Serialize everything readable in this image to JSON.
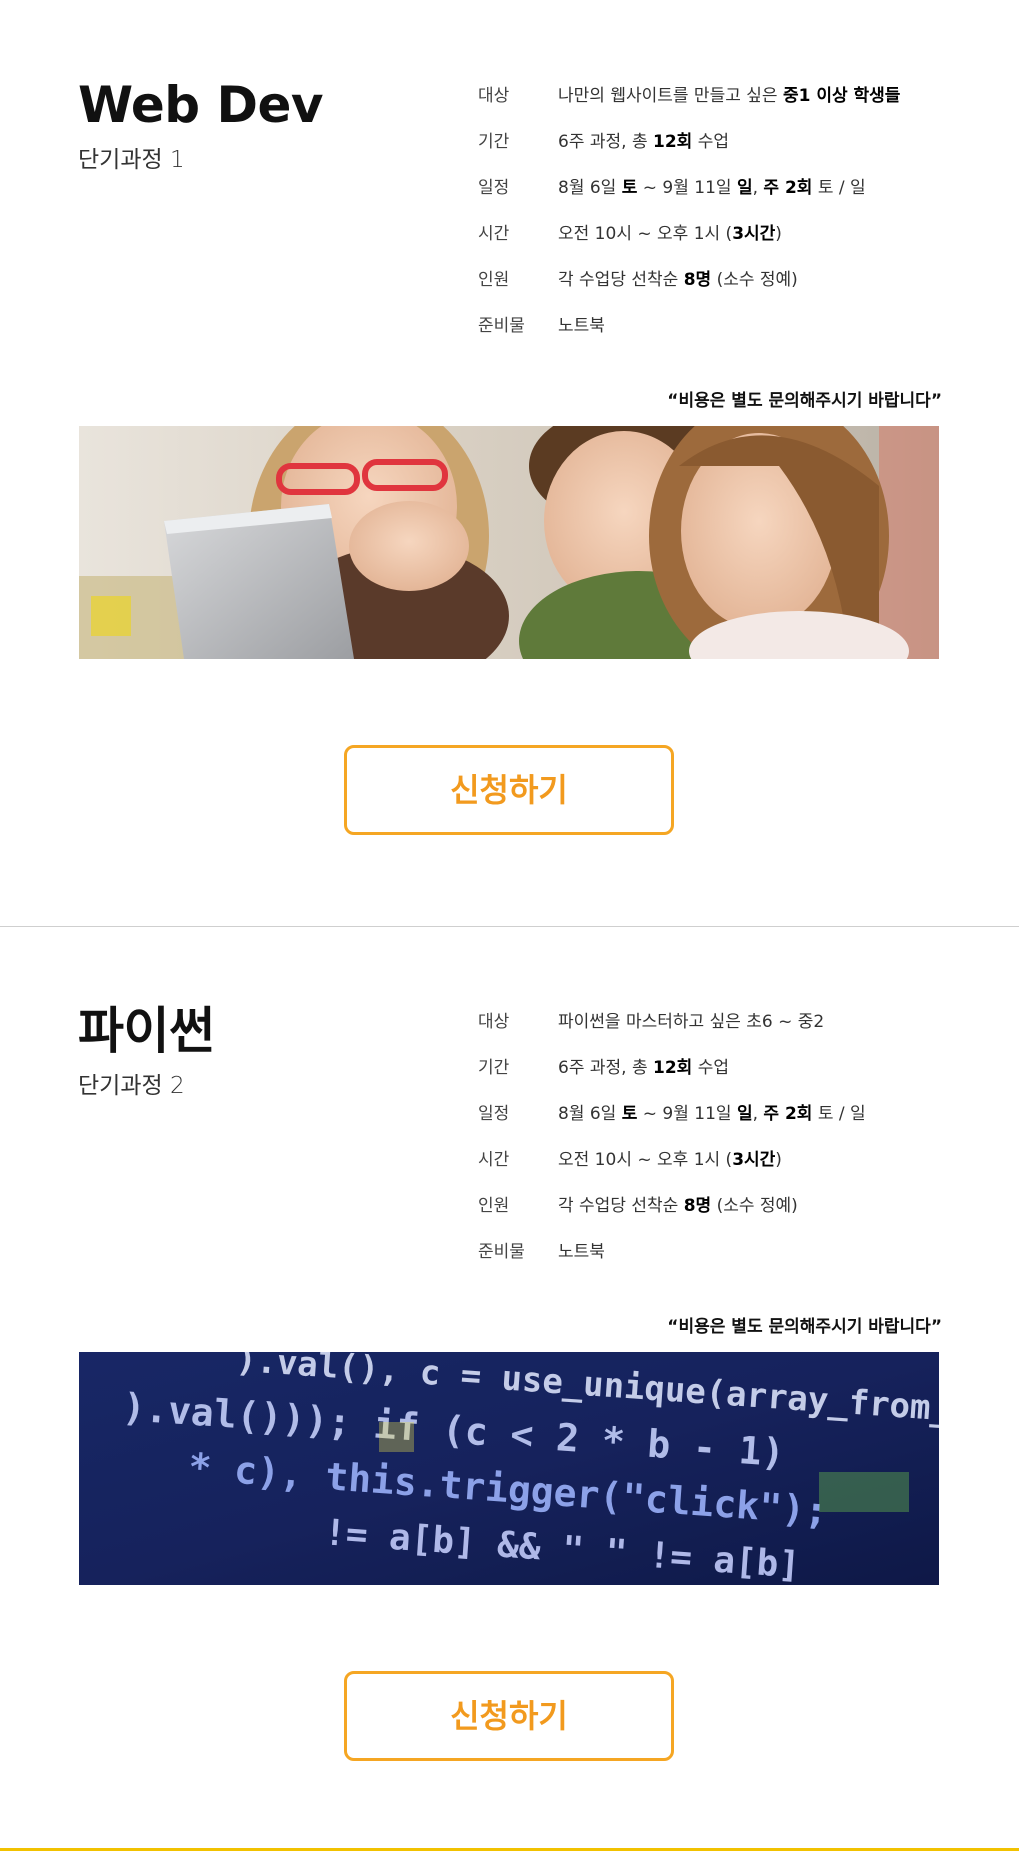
{
  "courses": [
    {
      "title": "Web Dev",
      "subtitle": "단기과정 1",
      "info": [
        {
          "label": "대상",
          "parts": [
            {
              "t": "나만의 웹사이트를 만들고 싶은 ",
              "b": false
            },
            {
              "t": "중1 이상 학생들",
              "b": true
            }
          ]
        },
        {
          "label": "기간",
          "parts": [
            {
              "t": "6주 과정, 총 ",
              "b": false
            },
            {
              "t": "12회",
              "b": true
            },
            {
              "t": " 수업",
              "b": false
            }
          ]
        },
        {
          "label": "일정",
          "parts": [
            {
              "t": "8월 6일 ",
              "b": false
            },
            {
              "t": "토",
              "b": true
            },
            {
              "t": " ~ 9월 11일 ",
              "b": false
            },
            {
              "t": "일",
              "b": true
            },
            {
              "t": ", ",
              "b": false
            },
            {
              "t": "주 2회",
              "b": true
            },
            {
              "t": " 토 / 일",
              "b": false
            }
          ]
        },
        {
          "label": "시간",
          "parts": [
            {
              "t": "오전 10시 ~ 오후 1시 (",
              "b": false
            },
            {
              "t": "3시간",
              "b": true
            },
            {
              "t": ")",
              "b": false
            }
          ]
        },
        {
          "label": "인원",
          "parts": [
            {
              "t": "각 수업당 선착순 ",
              "b": false
            },
            {
              "t": "8명",
              "b": true
            },
            {
              "t": " (소수 정예)",
              "b": false
            }
          ]
        },
        {
          "label": "준비물",
          "parts": [
            {
              "t": "노트북",
              "b": false
            }
          ]
        }
      ],
      "note": "“비용은 별도 문의해주시기 바랍니다”",
      "banner_icon": "kids-with-laptop-photo",
      "apply_label": "신청하기"
    },
    {
      "title": "파이썬",
      "subtitle": "단기과정 2",
      "info": [
        {
          "label": "대상",
          "parts": [
            {
              "t": "파이썬을 마스터하고 싶은 초6 ~ 중2",
              "b": false
            }
          ]
        },
        {
          "label": "기간",
          "parts": [
            {
              "t": "6주 과정, 총 ",
              "b": false
            },
            {
              "t": "12회",
              "b": true
            },
            {
              "t": " 수업",
              "b": false
            }
          ]
        },
        {
          "label": "일정",
          "parts": [
            {
              "t": "8월 6일 ",
              "b": false
            },
            {
              "t": "토",
              "b": true
            },
            {
              "t": " ~ 9월 11일 ",
              "b": false
            },
            {
              "t": "일",
              "b": true
            },
            {
              "t": ", ",
              "b": false
            },
            {
              "t": "주 2회",
              "b": true
            },
            {
              "t": " 토 / 일",
              "b": false
            }
          ]
        },
        {
          "label": "시간",
          "parts": [
            {
              "t": "오전 10시 ~ 오후 1시 (",
              "b": false
            },
            {
              "t": "3시간",
              "b": true
            },
            {
              "t": ")",
              "b": false
            }
          ]
        },
        {
          "label": "인원",
          "parts": [
            {
              "t": "각 수업당 선착순 ",
              "b": false
            },
            {
              "t": "8명",
              "b": true
            },
            {
              "t": " (소수 정예)",
              "b": false
            }
          ]
        },
        {
          "label": "준비물",
          "parts": [
            {
              "t": "노트북",
              "b": false
            }
          ]
        }
      ],
      "note": "“비용은 별도 문의해주시기 바랍니다”",
      "banner_icon": "code-screen-photo",
      "banner_code": {
        "line1": ").val(), c = use_unique(array_from_",
        "line2": ").val())); if (c < 2 * b - 1)",
        "line3": "* c), this.trigger(\"click\");",
        "line4": "!= a[b] && \" \" != a[b]"
      },
      "apply_label": "신청하기"
    }
  ],
  "colors": {
    "accent": "#f5a623",
    "accent_text": "#f29a1e",
    "divider": "#cfcfcf",
    "bottom_bar": "#f2c200"
  }
}
